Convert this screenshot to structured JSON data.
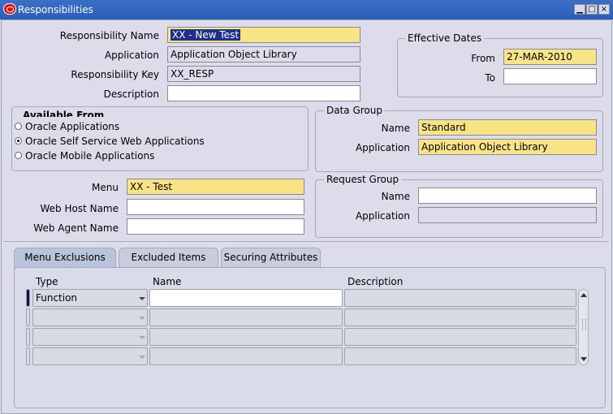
{
  "window": {
    "title": "Responsibilities",
    "minimize_glyph": "▁",
    "maximize_glyph": "□",
    "close_glyph": "×"
  },
  "form": {
    "responsibility_name": {
      "label": "Responsibility Name",
      "value": "XX - New Test"
    },
    "application": {
      "label": "Application",
      "value": "Application Object Library"
    },
    "responsibility_key": {
      "label": "Responsibility Key",
      "value": "XX_RESP"
    },
    "description": {
      "label": "Description",
      "value": ""
    }
  },
  "effective_dates": {
    "title": "Effective Dates",
    "from_label": "From",
    "from_value": "27-MAR-2010",
    "to_label": "To",
    "to_value": ""
  },
  "available_from": {
    "title": "Available From",
    "options": [
      {
        "label": "Oracle Applications",
        "selected": false
      },
      {
        "label": "Oracle Self Service Web Applications",
        "selected": true
      },
      {
        "label": "Oracle Mobile Applications",
        "selected": false
      }
    ]
  },
  "data_group": {
    "title": "Data Group",
    "name_label": "Name",
    "name_value": "Standard",
    "application_label": "Application",
    "application_value": "Application Object Library"
  },
  "menu_section": {
    "menu_label": "Menu",
    "menu_value": "XX - Test",
    "web_host_label": "Web Host Name",
    "web_host_value": "",
    "web_agent_label": "Web Agent Name",
    "web_agent_value": ""
  },
  "request_group": {
    "title": "Request Group",
    "name_label": "Name",
    "name_value": "",
    "application_label": "Application",
    "application_value": ""
  },
  "tabs": [
    {
      "label": "Menu Exclusions",
      "active": true
    },
    {
      "label": "Excluded Items",
      "active": false
    },
    {
      "label": "Securing Attributes",
      "active": false
    }
  ],
  "exclusions": {
    "columns": {
      "type": "Type",
      "name": "Name",
      "description": "Description"
    },
    "rows": [
      {
        "type": "Function",
        "name": "",
        "description": ""
      },
      {
        "type": "",
        "name": "",
        "description": ""
      },
      {
        "type": "",
        "name": "",
        "description": ""
      },
      {
        "type": "",
        "name": "",
        "description": ""
      }
    ]
  },
  "icons": {
    "title_logo": "oracle-logo-icon",
    "dropdown": "chevron-down-icon",
    "scroll_up": "scroll-up-icon",
    "scroll_down": "scroll-down-icon"
  },
  "colors": {
    "required_field": "#f8e484",
    "title_bar": "#2a5db6",
    "background": "#dcdcea",
    "selected_text": "#1f2f8e"
  }
}
